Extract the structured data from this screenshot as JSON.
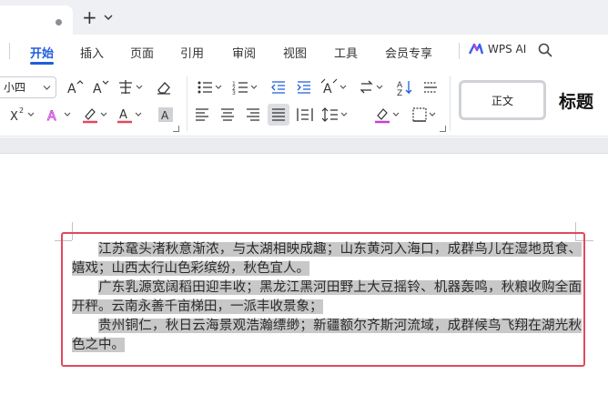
{
  "title_bar": {
    "new_tab_symbol": "+"
  },
  "menu": {
    "tabs": [
      "开始",
      "插入",
      "页面",
      "引用",
      "审阅",
      "视图",
      "工具",
      "会员专享"
    ],
    "active_tab": "开始",
    "ai_label": "WPS AI"
  },
  "ribbon": {
    "font_size_value": "小四",
    "styles": {
      "normal_label": "正文",
      "heading_label": "标题"
    },
    "icons": {
      "row1": [
        "increase-font-size-icon",
        "decrease-font-size-icon",
        "pinyin-guide-icon",
        "clear-format-icon",
        "bullet-list-icon",
        "numbered-list-icon",
        "decrease-indent-icon",
        "increase-indent-icon",
        "character-spacing-icon",
        "text-direction-icon",
        "sort-icon",
        "show-marks-icon"
      ],
      "row2": [
        "superscript-icon",
        "text-effect-icon",
        "highlight-icon",
        "font-color-icon",
        "character-shading-icon",
        "align-left-icon",
        "align-center-icon",
        "align-right-icon",
        "justify-icon",
        "distributed-icon",
        "line-spacing-icon",
        "paragraph-shading-icon",
        "borders-icon"
      ]
    },
    "accent_colors": {
      "active_tab": "#1f5ddc",
      "highlight": "#e0495f"
    }
  },
  "document": {
    "paragraphs": [
      "江苏鼋头渚秋意渐浓，与太湖相映成趣；山东黄河入海口，成群鸟儿在湿地觅食、嬉戏；山西太行山色彩缤纷，秋色宜人。",
      "广东乳源宽阔稻田迎丰收；黑龙江黑河田野上大豆摇铃、机器轰鸣，秋粮收购全面开秤。云南永善千亩梯田，一派丰收景象；",
      "贵州铜仁，秋日云海景观浩瀚缥缈；新疆额尔齐斯河流域，成群候鸟飞翔在湖光秋色之中。"
    ],
    "selection_color": "#c8c8c8",
    "annotation_box_color": "#e0495f"
  }
}
